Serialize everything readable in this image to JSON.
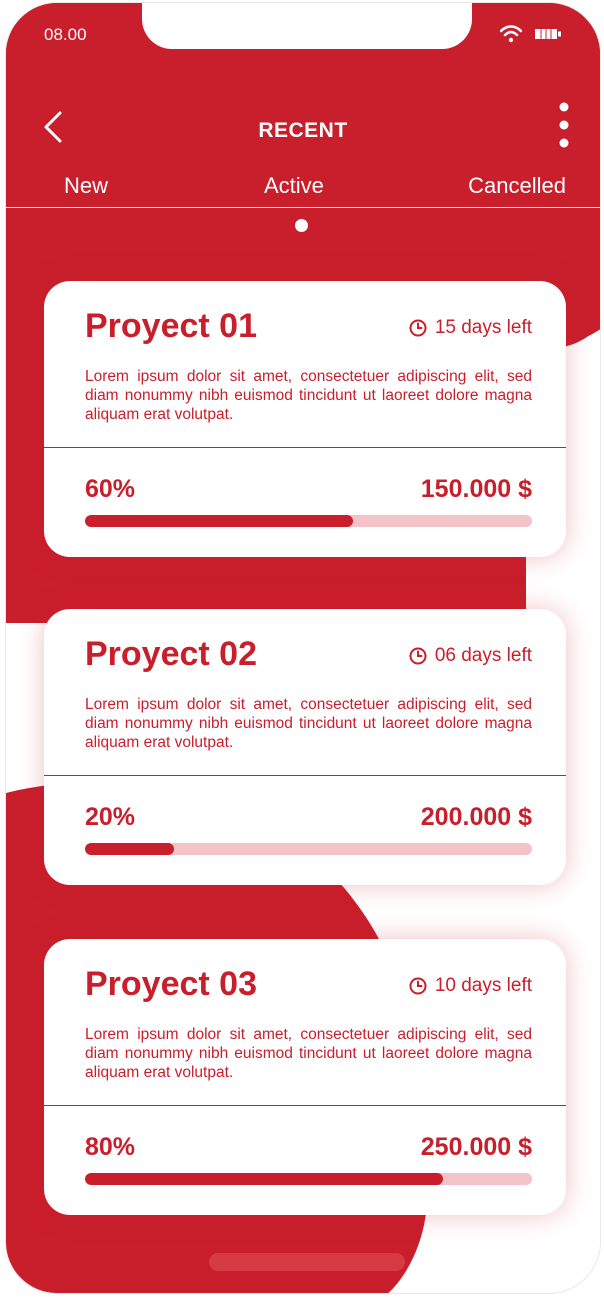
{
  "status": {
    "time": "08.00"
  },
  "header": {
    "title": "RECENT"
  },
  "tabs": [
    {
      "label": "New"
    },
    {
      "label": "Active"
    },
    {
      "label": "Cancelled"
    }
  ],
  "projects": [
    {
      "title": "Proyect 01",
      "days_left": "15 days left",
      "description": "Lorem ipsum dolor sit amet, consectetuer adipiscing elit, sed diam nonummy nibh euismod tincidunt ut laoreet dolore magna aliquam erat volutpat.",
      "percent_label": "60%",
      "progress": 0.6,
      "amount": "150.000 $"
    },
    {
      "title": "Proyect 02",
      "days_left": "06 days left",
      "description": "Lorem ipsum dolor sit amet, consectetuer adipiscing elit, sed diam nonummy nibh euismod tincidunt ut laoreet dolore magna aliquam erat volutpat.",
      "percent_label": "20%",
      "progress": 0.2,
      "amount": "200.000 $"
    },
    {
      "title": "Proyect 03",
      "days_left": "10 days left",
      "description": "Lorem ipsum dolor sit amet, consectetuer adipiscing elit, sed diam nonummy nibh euismod tincidunt ut laoreet dolore magna aliquam erat volutpat.",
      "percent_label": "80%",
      "progress": 0.8,
      "amount": "250.000 $"
    }
  ],
  "colors": {
    "brand_red": "#c91e2b",
    "track": "#f3c3c7"
  }
}
